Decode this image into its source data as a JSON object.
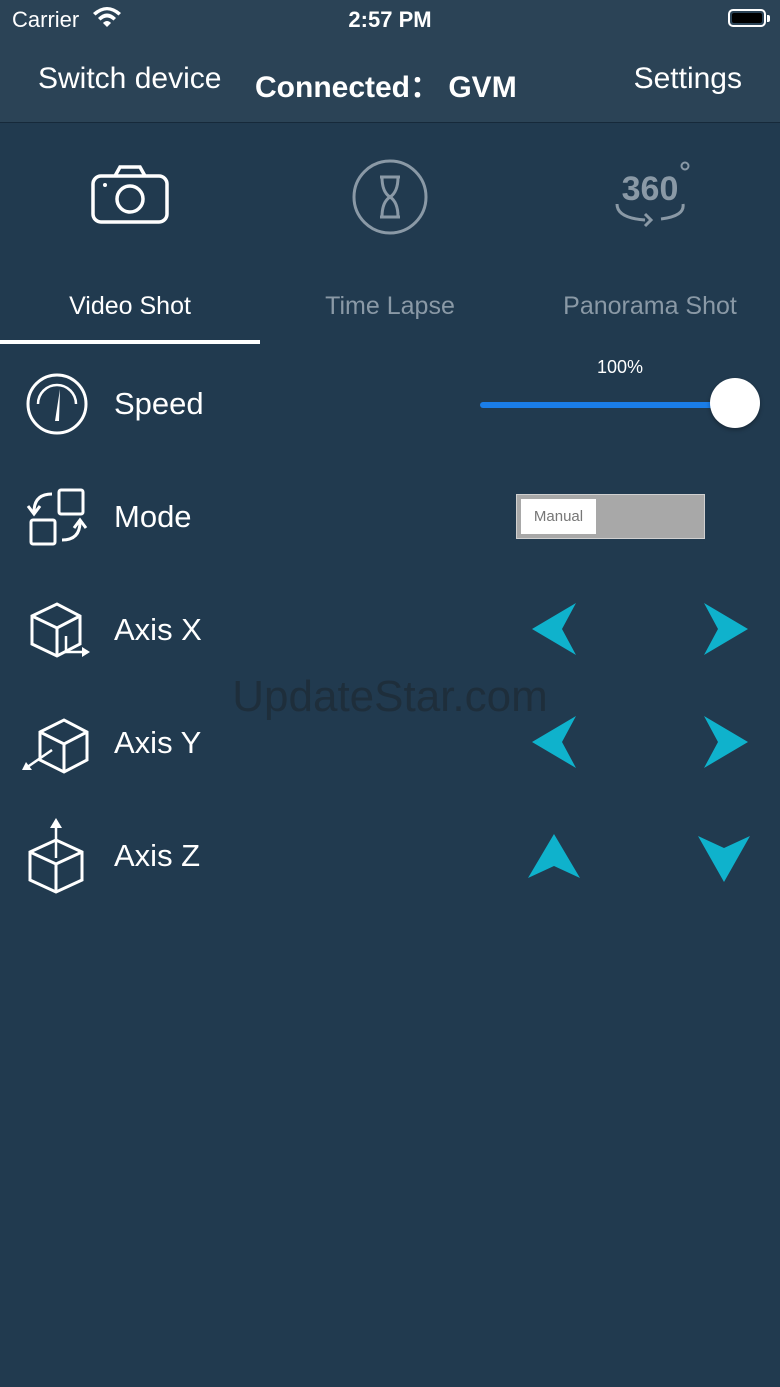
{
  "status": {
    "carrier": "Carrier",
    "time": "2:57 PM"
  },
  "nav": {
    "switch_label": "Switch device",
    "connected_label": "Connected： GVM",
    "settings_label": "Settings"
  },
  "mode_icons": [
    "camera-icon",
    "hourglass-icon",
    "rotate-360-icon"
  ],
  "tabs": [
    {
      "label": "Video Shot",
      "active": true
    },
    {
      "label": "Time Lapse",
      "active": false
    },
    {
      "label": "Panorama Shot",
      "active": false
    }
  ],
  "rows": {
    "speed": {
      "label": "Speed",
      "value_text": "100%",
      "value": 1.0
    },
    "mode": {
      "label": "Mode",
      "toggle_label": "Manual"
    },
    "axis_x": {
      "label": "Axis X"
    },
    "axis_y": {
      "label": "Axis Y"
    },
    "axis_z": {
      "label": "Axis Z"
    }
  },
  "colors": {
    "background": "#213a4f",
    "bar": "#2b4356",
    "accent": "#0fb2cc",
    "slider": "#1a7de8"
  },
  "watermark": "UpdateStar.com"
}
